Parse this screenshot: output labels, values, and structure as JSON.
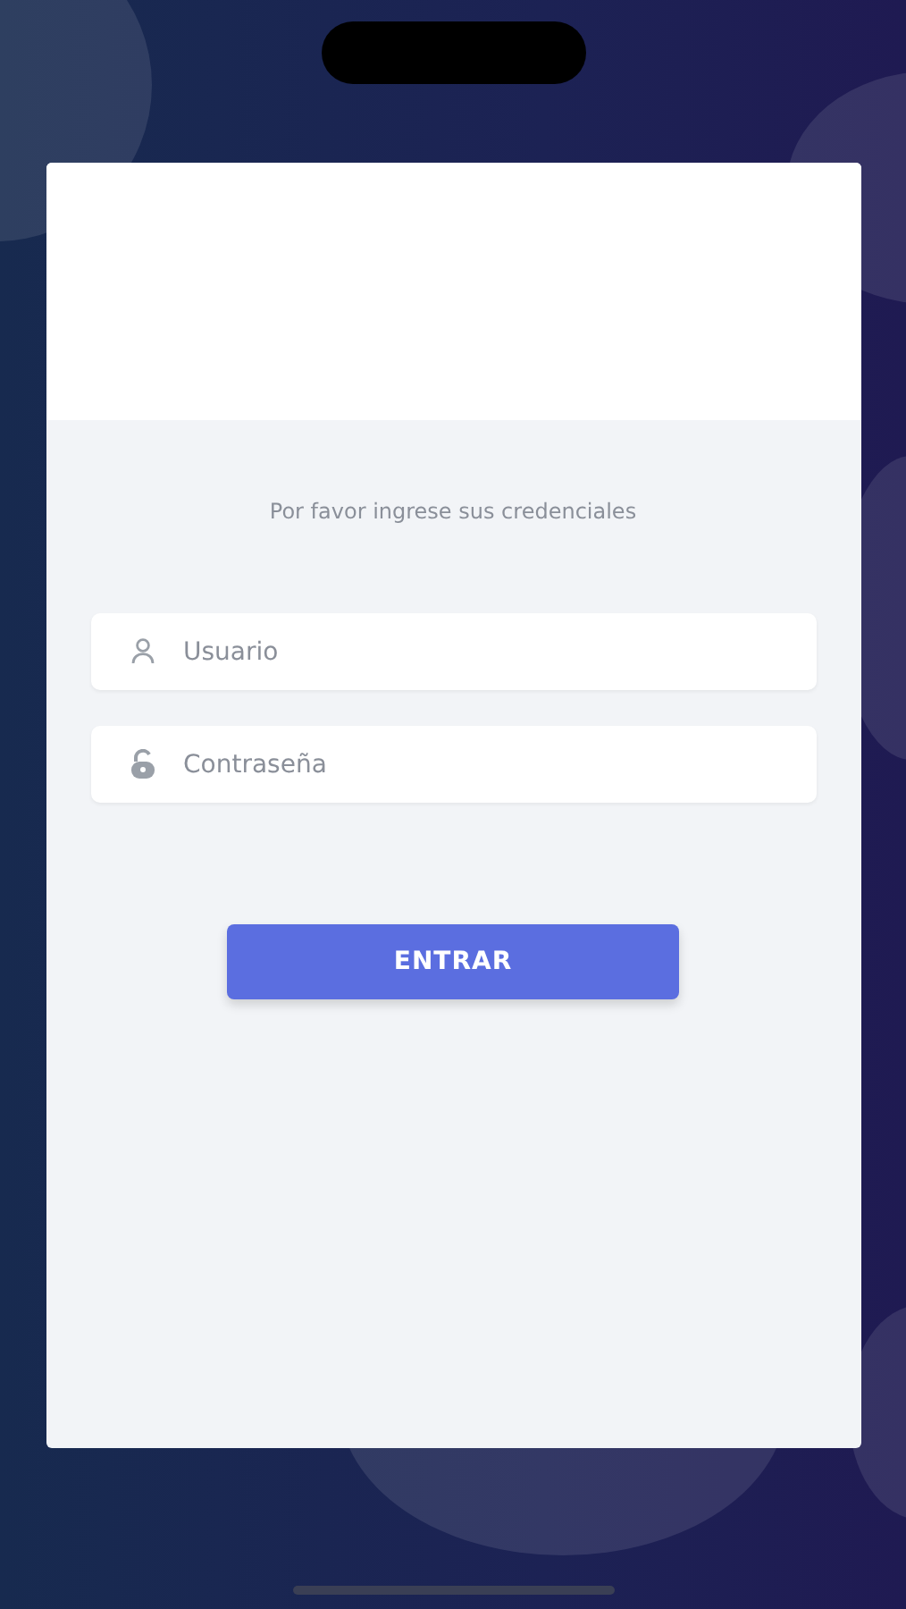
{
  "login": {
    "prompt": "Por favor ingrese sus credenciales",
    "fields": [
      {
        "kind": "user",
        "placeholder": "Usuario"
      },
      {
        "kind": "password",
        "placeholder": "Contraseña"
      }
    ],
    "button": "ENTRAR"
  }
}
